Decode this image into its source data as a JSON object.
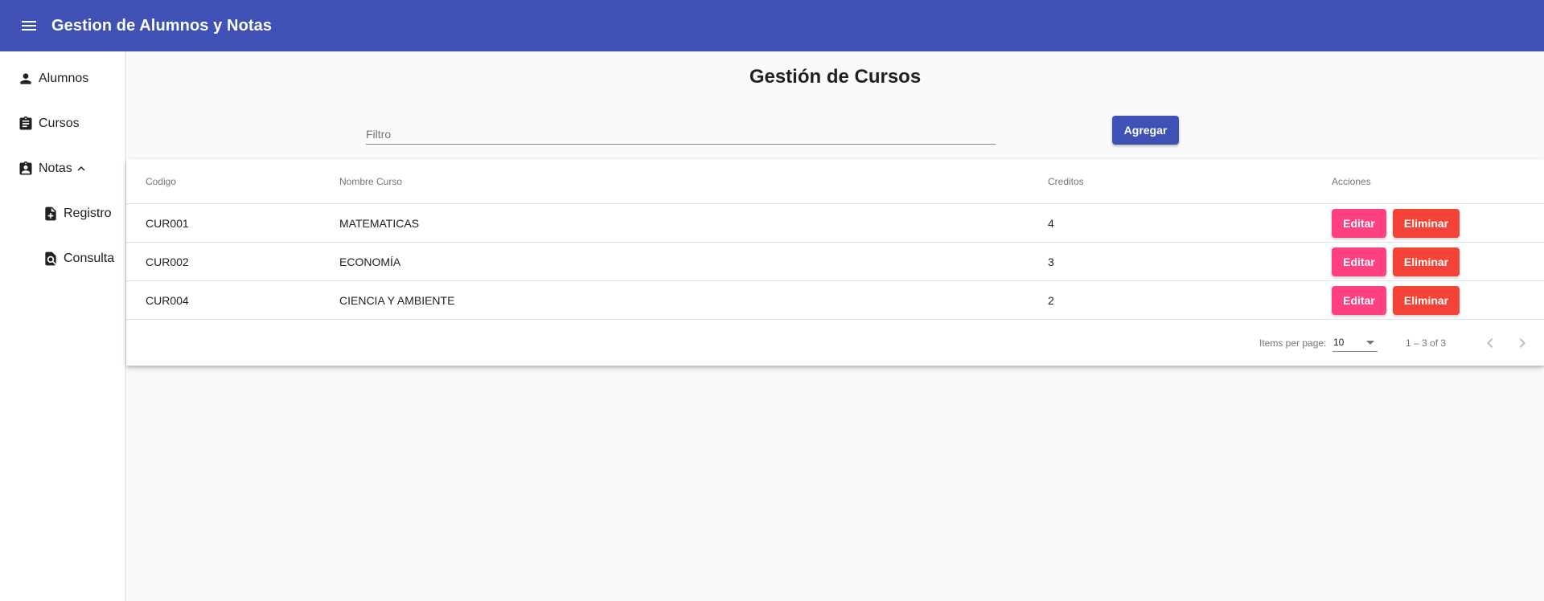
{
  "app": {
    "title": "Gestion de Alumnos y Notas",
    "menu_icon": "menu-icon"
  },
  "colors": {
    "primary": "#3f51b5",
    "accent": "#ff4081",
    "warn": "#f44336"
  },
  "sidebar": {
    "items": [
      {
        "label": "Alumnos",
        "icon": "person-icon"
      },
      {
        "label": "Cursos",
        "icon": "assignment-icon"
      },
      {
        "label": "Notas",
        "icon": "assignment-ind-icon",
        "expanded": true,
        "expand_icon": "chevron-up-icon"
      },
      {
        "label": "Registro",
        "icon": "note-add-icon"
      },
      {
        "label": "Consulta",
        "icon": "find-in-page-icon"
      }
    ]
  },
  "main": {
    "title": "Gestión de Cursos",
    "filter_placeholder": "Filtro",
    "filter_value": "",
    "add_label": "Agregar"
  },
  "table": {
    "columns": [
      "Codigo",
      "Nombre Curso",
      "Creditos",
      "Acciones"
    ],
    "rows": [
      {
        "codigo": "CUR001",
        "nombre": "MATEMATICAS",
        "creditos": "4"
      },
      {
        "codigo": "CUR002",
        "nombre": "ECONOMÍA",
        "creditos": "3"
      },
      {
        "codigo": "CUR004",
        "nombre": "CIENCIA Y AMBIENTE",
        "creditos": "2"
      }
    ],
    "edit_label": "Editar",
    "delete_label": "Eliminar"
  },
  "paginator": {
    "items_per_page_label": "Items per page:",
    "page_size": "10",
    "range_label": "1 – 3 of 3"
  }
}
